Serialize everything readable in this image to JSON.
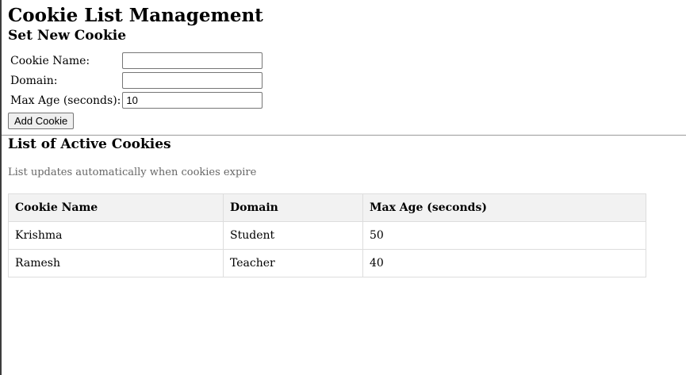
{
  "page": {
    "title": "Cookie List Management"
  },
  "form": {
    "heading": "Set New Cookie",
    "name_label": "Cookie Name:",
    "name_value": "",
    "domain_label": "Domain:",
    "domain_value": "",
    "maxage_label": "Max Age (seconds):",
    "maxage_value": "10",
    "submit_label": "Add Cookie"
  },
  "list": {
    "heading": "List of Active Cookies",
    "note": "List updates automatically when cookies expire",
    "columns": [
      "Cookie Name",
      "Domain",
      "Max Age (seconds)"
    ],
    "rows": [
      {
        "name": "Krishma",
        "domain": "Student",
        "max_age": "50"
      },
      {
        "name": "Ramesh",
        "domain": "Teacher",
        "max_age": "40"
      }
    ]
  }
}
